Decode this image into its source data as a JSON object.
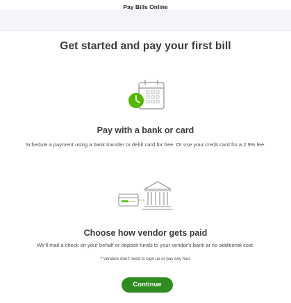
{
  "window": {
    "title": "Pay Bills Online"
  },
  "main": {
    "heading": "Get started and pay your first bill",
    "sections": [
      {
        "icon": "calendar-clock-icon",
        "title": "Pay with a bank or card",
        "description": "Schedule a payment using a bank transfer or debit card for free. Or use your credit card for a 2.9% fee."
      },
      {
        "icon": "bank-transfer-icon",
        "title": "Choose how vendor gets paid",
        "description": "We'll mail a check on your behalf or deposit funds to your vendor's bank at no additional cost."
      }
    ],
    "note": "* Vendors don't need to sign up or pay any fees",
    "continue_label": "Continue"
  },
  "colors": {
    "accent_green": "#2e8b1f",
    "icon_green": "#53b700",
    "text": "#393a3d",
    "band": "#f4f5f8"
  }
}
